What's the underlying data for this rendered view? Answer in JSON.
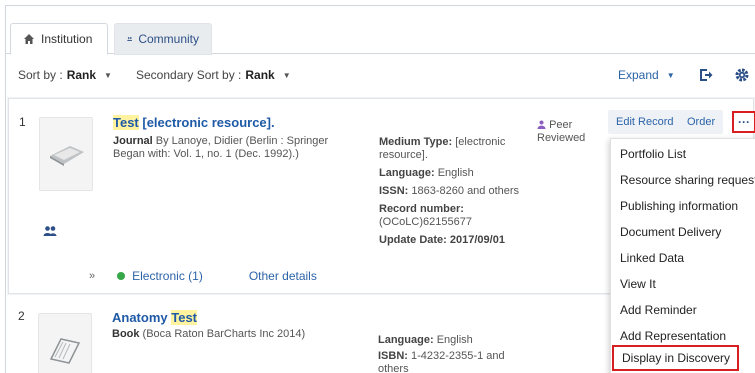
{
  "tabs": [
    {
      "label": "Institution",
      "icon": "home-icon",
      "active": true
    },
    {
      "label": "Community",
      "icon": "users-icon",
      "active": false
    }
  ],
  "sortbar": {
    "sort_label": "Sort by :",
    "sort_value": "Rank",
    "secondary_label": "Secondary Sort by :",
    "secondary_value": "Rank",
    "expand_label": "Expand"
  },
  "results": [
    {
      "number": "1",
      "title_highlight": "Test",
      "title_rest": " [electronic resource].",
      "type": "Journal",
      "desc_line1_rest": " By Lanoye, Didier (Berlin : Springer",
      "desc_line2": "Began with: Vol. 1, no. 1 (Dec. 1992).)",
      "medium_label": "Medium Type:",
      "medium_value": "[electronic resource].",
      "language_label": "Language:",
      "language_value": "English",
      "issn_label": "ISSN:",
      "issn_value": "1863-8260 and others",
      "record_label": "Record number:",
      "record_value": "(OCoLC)62155677",
      "update_label": "Update Date:",
      "update_value": "2017/09/01",
      "peer_label": "Peer Reviewed",
      "electronic_label": "Electronic (1)",
      "other_details": "Other details"
    },
    {
      "number": "2",
      "title_prefix": "Anatomy ",
      "title_highlight": "Test",
      "type": "Book",
      "desc_rest": " (Boca Raton BarCharts Inc 2014)",
      "language_label": "Language:",
      "language_value": "English",
      "isbn_label": "ISBN:",
      "isbn_value": "1-4232-2355-1 and others"
    }
  ],
  "actions": {
    "edit_record": "Edit Record",
    "order": "Order",
    "more": "···"
  },
  "menu": [
    "Portfolio List",
    "Resource sharing request",
    "Publishing information",
    "Document Delivery",
    "Linked Data",
    "View It",
    "Add Reminder",
    "Add Representation",
    "Display in Discovery"
  ],
  "colors": {
    "link": "#2c64a8",
    "highlight_border": "#d81e1e",
    "available": "#36a84a"
  }
}
